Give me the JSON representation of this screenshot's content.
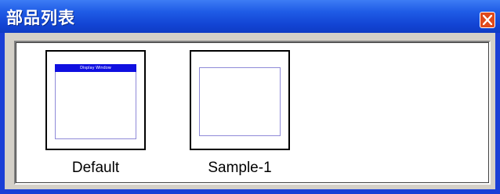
{
  "window": {
    "title": "部品列表",
    "close_icon": "close-icon"
  },
  "items": [
    {
      "label": "Default",
      "preview": {
        "header_text": "Display Window",
        "header_color": "#1010e0"
      }
    },
    {
      "label": "Sample-1",
      "preview": {
        "header_text": ""
      }
    }
  ],
  "colors": {
    "titlebar": "#1f5ce6",
    "close_button": "#e04a1c",
    "page_border": "#8f8ad8"
  }
}
